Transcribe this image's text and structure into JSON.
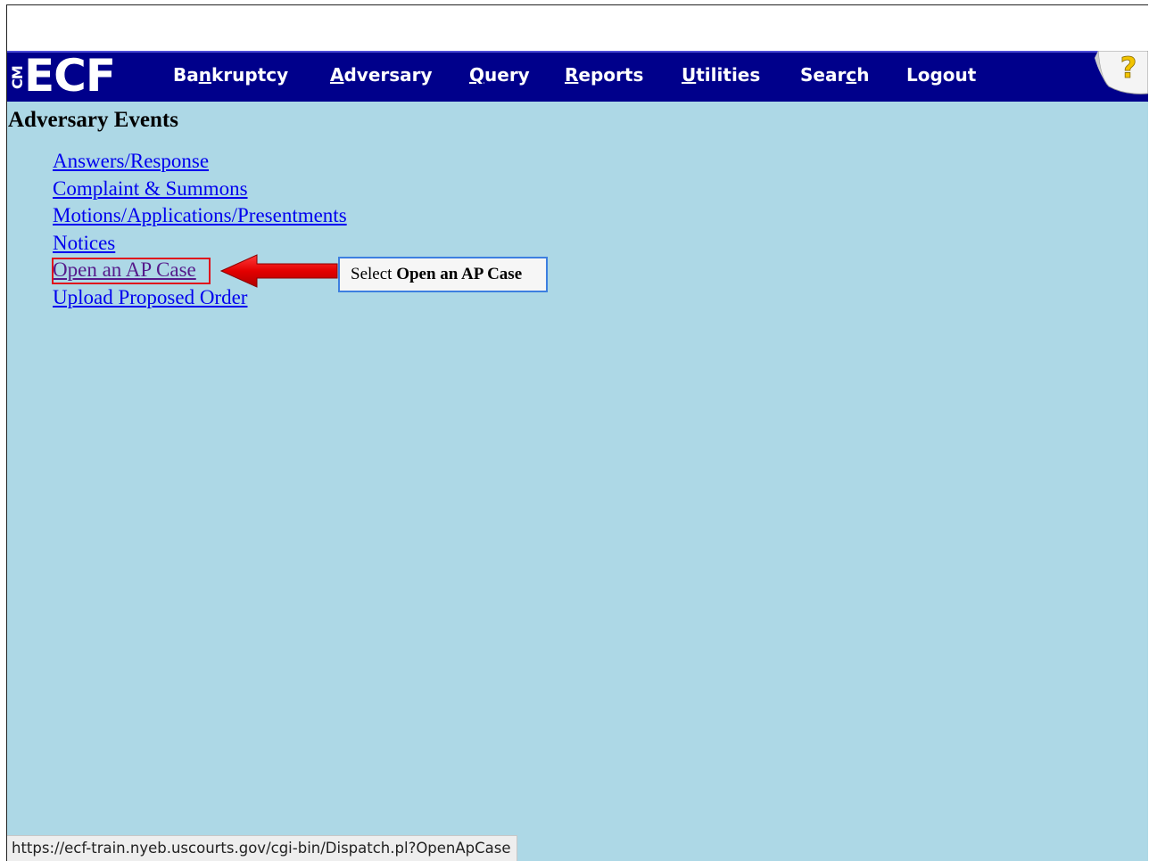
{
  "navbar": {
    "logo": {
      "cm": "CM",
      "ecf": "ECF"
    },
    "menu": [
      {
        "pre": "Ba",
        "ul": "n",
        "post": "kruptcy"
      },
      {
        "pre": "",
        "ul": "A",
        "post": "dversary"
      },
      {
        "pre": "",
        "ul": "Q",
        "post": "uery"
      },
      {
        "pre": "",
        "ul": "R",
        "post": "eports"
      },
      {
        "pre": "",
        "ul": "U",
        "post": "tilities"
      },
      {
        "pre": "Sear",
        "ul": "c",
        "post": "h"
      },
      {
        "pre": "Logout",
        "ul": "",
        "post": ""
      }
    ],
    "help_icon": "help-question-icon",
    "colors": {
      "bar": "#00008b",
      "text": "#ffffff"
    }
  },
  "main": {
    "title": "Adversary Events",
    "links": [
      "Answers/Response",
      "Complaint & Summons",
      "Motions/Applications/Presentments",
      "Notices",
      "Open an AP Case",
      "Upload Proposed Order"
    ],
    "background": "#add8e6"
  },
  "annotation": {
    "prefix": "Select ",
    "emphasis": "Open an AP Case",
    "highlight_color": "#e0101c",
    "arrow_icon": "left-arrow-icon",
    "callout_border": "#3d7fe0"
  },
  "status_bar": {
    "url": "https://ecf-train.nyeb.uscourts.gov/cgi-bin/Dispatch.pl?OpenApCase"
  }
}
